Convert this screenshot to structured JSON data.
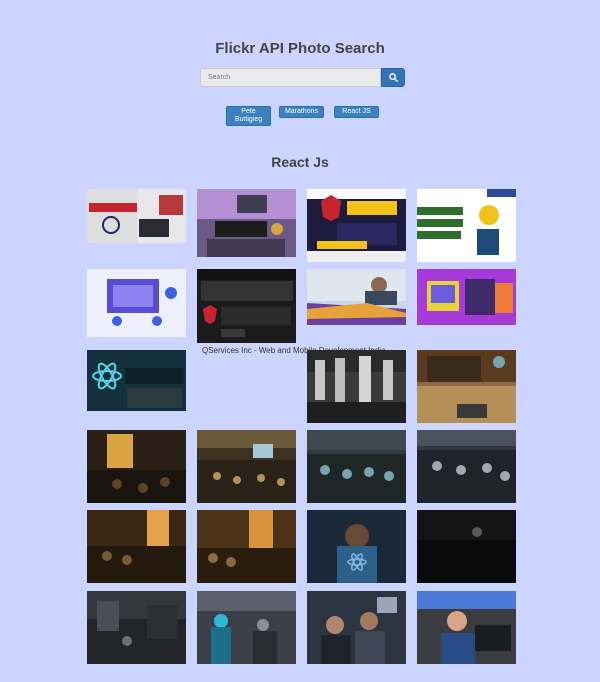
{
  "header": {
    "title": "Flickr API Photo Search"
  },
  "search": {
    "placeholder": "Search"
  },
  "chips": [
    {
      "label": "Pete Buttigieg"
    },
    {
      "label": "Marathons"
    },
    {
      "label": "React JS"
    }
  ],
  "results": {
    "heading": "React Js",
    "broken_image_alt": "QServices Inc - Web and Mobile Development India"
  },
  "photos": [
    {
      "id": "p1",
      "bg": "#e8e8ea",
      "accent": "#c6252f"
    },
    {
      "id": "p2",
      "bg": "#6a5a86",
      "accent": "#2b2b2b"
    },
    {
      "id": "p3",
      "bg": "#1d1b3e",
      "accent": "#f2c21b"
    },
    {
      "id": "p4",
      "bg": "#ffffff",
      "accent": "#4a8a3a"
    },
    {
      "id": "p5",
      "bg": "#eef0fb",
      "accent": "#5a4dd1"
    },
    {
      "id": "p6",
      "bg": "#1b1b1b",
      "accent": "#c6252f"
    },
    {
      "id": "p7",
      "bg": "#c9d7e6",
      "accent": "#6a3fa0"
    },
    {
      "id": "p8",
      "bg": "#a53ad9",
      "accent": "#e8d23a"
    },
    {
      "id": "p9",
      "bg": "#14303a",
      "accent": "#59d2ef"
    },
    {
      "id": "p10",
      "bg": "#3a3a3a",
      "accent": "#8a8a8a"
    },
    {
      "id": "p11",
      "bg": "#8d6a45",
      "accent": "#3a2a1b"
    },
    {
      "id": "p12",
      "bg": "#5c4428",
      "accent": "#d9a441"
    },
    {
      "id": "p13",
      "bg": "#3d3122",
      "accent": "#b29158"
    },
    {
      "id": "p14",
      "bg": "#2f3a3e",
      "accent": "#7aa3b0"
    },
    {
      "id": "p15",
      "bg": "#2f3742",
      "accent": "#a3a8b0"
    },
    {
      "id": "p16",
      "bg": "#5a3a1e",
      "accent": "#e2a14a"
    },
    {
      "id": "p17",
      "bg": "#4b3418",
      "accent": "#d8923a"
    },
    {
      "id": "p18",
      "bg": "#1a2838",
      "accent": "#7fb7e8"
    },
    {
      "id": "p19",
      "bg": "#141414",
      "accent": "#5a5a5a"
    },
    {
      "id": "p20",
      "bg": "#222428",
      "accent": "#6a6f78"
    },
    {
      "id": "p21",
      "bg": "#3a3f48",
      "accent": "#2db7d9"
    },
    {
      "id": "p22",
      "bg": "#2c3440",
      "accent": "#9aa6b8"
    },
    {
      "id": "p23",
      "bg": "#3a3c40",
      "accent": "#4b7bd6"
    }
  ]
}
